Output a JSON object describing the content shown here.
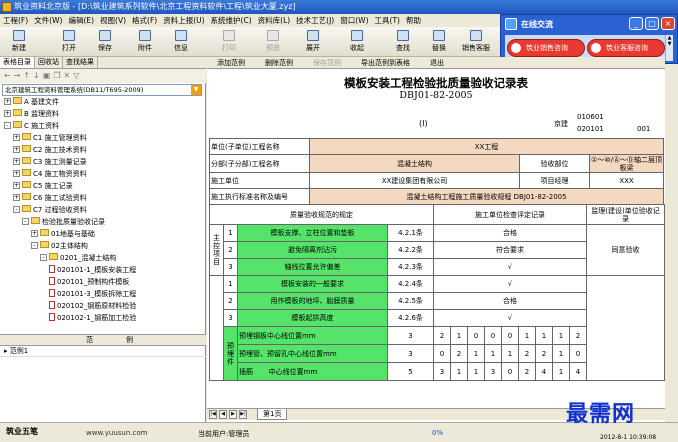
{
  "window": {
    "title": "筑业资料北京版 - [D:\\筑业建筑系列软件\\北京工程资料软件\\工程\\筑业大厦.zyz]",
    "menu": [
      "工程(F)",
      "文件(W)",
      "编辑(E)",
      "视图(V)",
      "格式(F)",
      "资料上报(U)",
      "系统维护(C)",
      "资料库(L)",
      "技术工艺(J)",
      "窗口(W)",
      "工具(T)",
      "帮助"
    ]
  },
  "toolbar": {
    "buttons": [
      {
        "label": "新建",
        "enabled": true
      },
      {
        "label": "打开",
        "enabled": true
      },
      {
        "label": "保存",
        "enabled": true
      },
      {
        "label": "附件",
        "enabled": true
      },
      {
        "label": "信息",
        "enabled": true
      },
      {
        "label": "打印",
        "enabled": false
      },
      {
        "label": "预览",
        "enabled": false
      },
      {
        "label": "展开",
        "enabled": true
      },
      {
        "label": "收起",
        "enabled": true
      },
      {
        "label": "查找",
        "enabled": true
      },
      {
        "label": "替换",
        "enabled": true
      },
      {
        "label": "销售客服",
        "enabled": true
      }
    ]
  },
  "chat": {
    "title": "在线交流",
    "buttons": [
      "筑业销售咨询",
      "筑业客服咨询"
    ]
  },
  "left": {
    "tabs": [
      "表格目录",
      "回收站",
      "查找结果"
    ],
    "select_value": "北京建筑工程资料管理系统(DB11/T695-2009)",
    "tree": [
      {
        "indent": 0,
        "type": "folder",
        "pm": "+",
        "label": "A 基建文件"
      },
      {
        "indent": 0,
        "type": "folder",
        "pm": "+",
        "label": "B 监理资料"
      },
      {
        "indent": 0,
        "type": "folder",
        "pm": "-",
        "label": "C 施工资料"
      },
      {
        "indent": 1,
        "type": "folder",
        "pm": "+",
        "label": "C1 施工管理资料"
      },
      {
        "indent": 1,
        "type": "folder",
        "pm": "+",
        "label": "C2 施工技术资料"
      },
      {
        "indent": 1,
        "type": "folder",
        "pm": "+",
        "label": "C3 施工测量记录"
      },
      {
        "indent": 1,
        "type": "folder",
        "pm": "+",
        "label": "C4 施工物资资料"
      },
      {
        "indent": 1,
        "type": "folder",
        "pm": "+",
        "label": "C5 施工记录"
      },
      {
        "indent": 1,
        "type": "folder",
        "pm": "+",
        "label": "C6 施工试验资料"
      },
      {
        "indent": 1,
        "type": "folder",
        "pm": "-",
        "label": "C7 过程验收资料"
      },
      {
        "indent": 2,
        "type": "folder",
        "pm": "-",
        "label": "检验批质量验收记录"
      },
      {
        "indent": 3,
        "type": "folder",
        "pm": "+",
        "label": "01地基与基础"
      },
      {
        "indent": 3,
        "type": "folder",
        "pm": "-",
        "label": "02主体结构"
      },
      {
        "indent": 4,
        "type": "folder",
        "pm": "-",
        "label": "0201_混凝土结构"
      },
      {
        "indent": 5,
        "type": "doc",
        "pm": "",
        "label": "020101-1_模板安装工程"
      },
      {
        "indent": 5,
        "type": "doc",
        "pm": "",
        "label": "020101_预制构件模板"
      },
      {
        "indent": 5,
        "type": "doc",
        "pm": "",
        "label": "020101-3_模板拆除工程"
      },
      {
        "indent": 5,
        "type": "doc",
        "pm": "",
        "label": "020102_钢筋原材料检验"
      },
      {
        "indent": 5,
        "type": "doc",
        "pm": "",
        "label": "020102-1_钢筋加工检验"
      }
    ],
    "bottom_header": [
      "范",
      "例"
    ],
    "bottom_row": "范例1"
  },
  "doc": {
    "tabs": [
      {
        "label": "添加范例",
        "enabled": true
      },
      {
        "label": "删除范例",
        "enabled": true
      },
      {
        "label": "保存范例",
        "enabled": false
      },
      {
        "label": "导出范例到表格",
        "enabled": true
      },
      {
        "label": "退出",
        "enabled": true
      }
    ],
    "title": "模板安装工程检验批质量验收记录表",
    "code": "DBJ01-82-2005",
    "paren": "(I)",
    "jingjian": "京建",
    "num1": "010601",
    "num2": "020101",
    "num3": "001",
    "header": {
      "unit_label": "单位(子单位)工程名称",
      "unit_value": "XX工程",
      "fenbu_label": "分部(子分部)工程名称",
      "fenbu_value": "混凝土结构",
      "yanshou_label": "验收部位",
      "yanshou_value": "①～⑩/Ⓐ～Ⓓ轴二层顶板梁",
      "sg_label": "施工单位",
      "sg_value": "XX建设集团有限公司",
      "pm_label": "项目经理",
      "pm_value": "XXX",
      "std_label": "施工执行标准名称及编号",
      "std_value": "混凝土结构工程施工质量验收规程 DBJ01-82-2005"
    },
    "col_headers": {
      "spec": "质量验收规范的规定",
      "record": "施工单位检查评定记录",
      "supervisor": "监理(建设)单位验收记录"
    },
    "main_label": "主控项目",
    "main_items": [
      {
        "no": "1",
        "text": "模板支撑、立柱位置和垫板",
        "clause": "4.2.1条",
        "record": "合格"
      },
      {
        "no": "2",
        "text": "避免隔离剂沾污",
        "clause": "4.2.2条",
        "record": "符合要求"
      },
      {
        "no": "3",
        "text": "轴线位置允许偏差",
        "clause": "4.2.3条",
        "record": "√"
      }
    ],
    "main_supervisor": "同意验收",
    "general_items": [
      {
        "no": "1",
        "text": "模板安装的一般要求",
        "clause": "4.2.4条",
        "record": "√"
      },
      {
        "no": "2",
        "text": "用作模板的地坪、胎膜质量",
        "clause": "4.2.5条",
        "record": "合格"
      },
      {
        "no": "3",
        "text": "模板起拱高度",
        "clause": "4.2.6条",
        "record": "√"
      }
    ],
    "embed_label": "预埋件",
    "embed_rows": [
      {
        "text": "预埋钢板中心线位置mm",
        "val": "3",
        "cells": [
          "2",
          "1",
          "0",
          "0",
          "0",
          "1",
          "1",
          "1",
          "2"
        ]
      },
      {
        "text": "预埋管、预留孔中心线位置mm",
        "val": "3",
        "cells": [
          "0",
          "2",
          "1",
          "1",
          "1",
          "2",
          "2",
          "1",
          "0"
        ]
      },
      {
        "text1": "插筋",
        "text2": "中心线位置mm",
        "val": "5",
        "cells": [
          "3",
          "1",
          "1",
          "3",
          "0",
          "2",
          "4",
          "1",
          "4"
        ]
      }
    ]
  },
  "sheetbar": {
    "tab": "第1页"
  },
  "status": {
    "logo": "筑业五笔",
    "url": "www.yuusun.com",
    "user": "当前用户:管理员",
    "pct": "0%",
    "time": "2012-8-1 10:39:08"
  },
  "watermark": "最需网"
}
